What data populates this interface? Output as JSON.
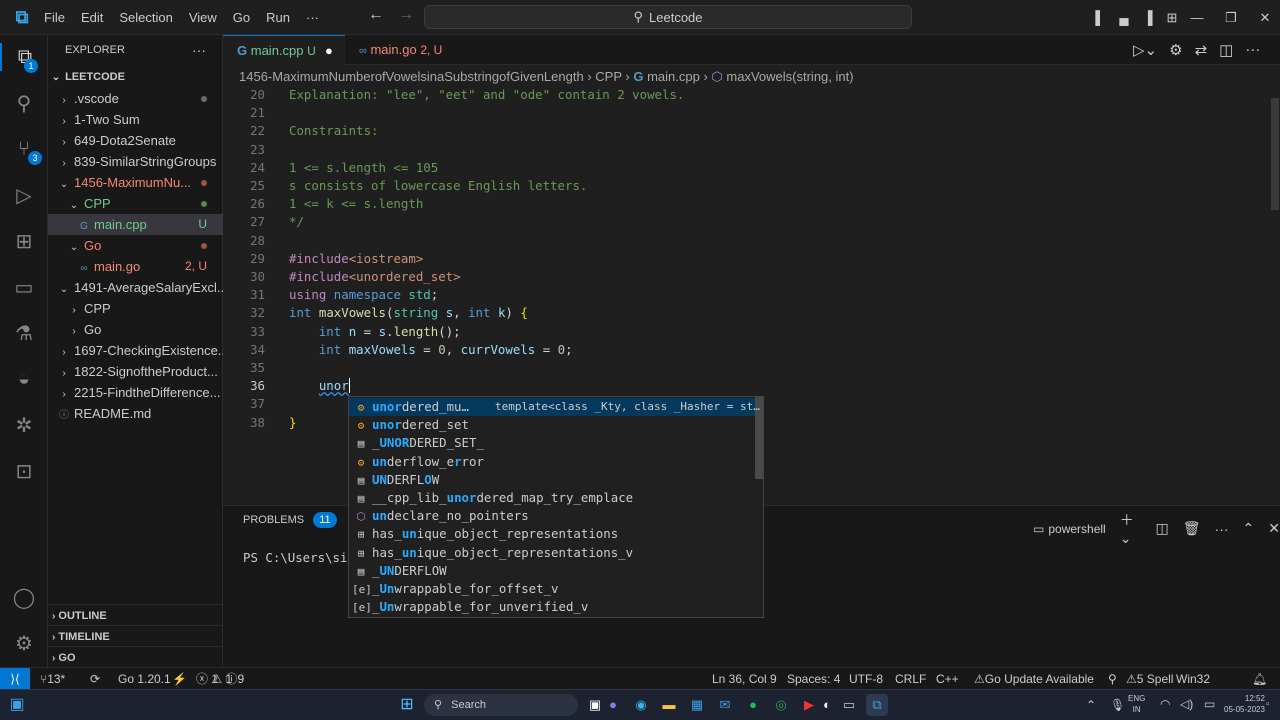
{
  "titlebar": {
    "menu": [
      "File",
      "Edit",
      "Selection",
      "View",
      "Go",
      "Run",
      "···"
    ],
    "command_center": "Leetcode"
  },
  "activity": {
    "explorer_badge": "1",
    "scm_badge": "3"
  },
  "sidebar": {
    "title": "EXPLORER",
    "root": "LEETCODE",
    "items": [
      {
        "label": ".vscode",
        "depth": 1,
        "chev": "›",
        "color": "#cccccc",
        "deco": "dot-gray"
      },
      {
        "label": "1-Two Sum",
        "depth": 1,
        "chev": "›",
        "color": "#cccccc"
      },
      {
        "label": "649-Dota2Senate",
        "depth": 1,
        "chev": "›",
        "color": "#cccccc"
      },
      {
        "label": "839-SimilarStringGroups",
        "depth": 1,
        "chev": "›",
        "color": "#cccccc"
      },
      {
        "label": "1456-MaximumNu...",
        "depth": 1,
        "chev": "⌄",
        "color": "#f48771",
        "deco": "dot-red"
      },
      {
        "label": "CPP",
        "depth": 2,
        "chev": "⌄",
        "color": "#73c991",
        "deco": "dot-green"
      },
      {
        "label": "main.cpp",
        "depth": 3,
        "chev": "",
        "color": "#73c991",
        "deco_text": "U",
        "selected": true
      },
      {
        "label": "Go",
        "depth": 2,
        "chev": "⌄",
        "color": "#f48771",
        "deco": "dot-red"
      },
      {
        "label": "main.go",
        "depth": 3,
        "chev": "",
        "color": "#f48771",
        "deco_text": "2, U"
      },
      {
        "label": "1491-AverageSalaryExcl...",
        "depth": 1,
        "chev": "⌄",
        "color": "#cccccc"
      },
      {
        "label": "CPP",
        "depth": 2,
        "chev": "›",
        "color": "#cccccc"
      },
      {
        "label": "Go",
        "depth": 2,
        "chev": "›",
        "color": "#cccccc"
      },
      {
        "label": "1697-CheckingExistence...",
        "depth": 1,
        "chev": "›",
        "color": "#cccccc"
      },
      {
        "label": "1822-SignoftheProduct...",
        "depth": 1,
        "chev": "›",
        "color": "#cccccc"
      },
      {
        "label": "2215-FindtheDifference...",
        "depth": 1,
        "chev": "›",
        "color": "#cccccc"
      },
      {
        "label": "README.md",
        "depth": 1,
        "chev": "",
        "color": "#cccccc",
        "icon": "info-icon"
      }
    ],
    "sections": [
      "OUTLINE",
      "TIMELINE",
      "GO"
    ]
  },
  "tabs": [
    {
      "label": "main.cpp",
      "suffix": "U",
      "color": "#73c991",
      "active": true
    },
    {
      "label": "main.go",
      "suffix": "2, U",
      "color": "#f48771",
      "active": false
    }
  ],
  "breadcrumbs": [
    "1456-MaximumNumberofVowelsinaSubstringofGivenLength",
    "CPP",
    "main.cpp",
    "maxVowels(string, int)"
  ],
  "code_lines": [
    {
      "n": "20",
      "html": "<span class='cm'>Explanation: \"lee\", \"eet\" and \"ode\" contain 2 vowels.</span>"
    },
    {
      "n": "21",
      "html": ""
    },
    {
      "n": "22",
      "html": "<span class='cm'>Constraints:</span>"
    },
    {
      "n": "23",
      "html": ""
    },
    {
      "n": "24",
      "html": "<span class='cm'>1 &lt;= s.length &lt;= 105</span>"
    },
    {
      "n": "25",
      "html": "<span class='cm'>s consists of lowercase English letters.</span>"
    },
    {
      "n": "26",
      "html": "<span class='cm'>1 &lt;= k &lt;= s.length</span>"
    },
    {
      "n": "27",
      "html": "<span class='cm'>*/</span>"
    },
    {
      "n": "28",
      "html": ""
    },
    {
      "n": "29",
      "html": "<span class='pp'>#include</span><span class='cm' style='color:#ce9178'>&lt;iostream&gt;</span>"
    },
    {
      "n": "30",
      "html": "<span class='pp'>#include</span><span class='cm' style='color:#ce9178'>&lt;unordered_set&gt;</span>"
    },
    {
      "n": "31",
      "html": "<span class='pp'>using</span> <span class='kw'>namespace</span> <span class='ty'>std</span>;"
    },
    {
      "n": "32",
      "html": "<span class='kw'>int</span> <span class='fn'>maxVowels</span>(<span class='ty'>string</span> <span class='vr'>s</span>, <span class='kw'>int</span> <span class='vr'>k</span>) <span style='color:#ffd700'>{</span>"
    },
    {
      "n": "33",
      "html": "    <span class='kw'>int</span> <span class='vr'>n</span> = <span class='vr'>s</span>.<span class='fn'>length</span>();"
    },
    {
      "n": "34",
      "html": "    <span class='kw'>int</span> <span class='vr'>maxVowels</span> = <span class='nm'>0</span>, <span class='vr'>currVowels</span> = <span class='nm'>0</span>;"
    },
    {
      "n": "35",
      "html": ""
    },
    {
      "n": "36",
      "html": "    <span class='vr' style='text-decoration:underline wavy #3794ff'>unor</span><span style='border-left:1px solid #fff'></span>"
    },
    {
      "n": "37",
      "html": ""
    },
    {
      "n": "38",
      "html": "<span style='color:#ffd700'>}</span>"
    }
  ],
  "autocomplete": [
    {
      "icon": "⚙",
      "pre": "",
      "hl": "unor",
      "post": "dered_mu…",
      "detail": "template<class _Kty, class _Hasher = st…",
      "active": true,
      "icon_name": "class-icon"
    },
    {
      "icon": "⚙",
      "pre": "",
      "hl": "unor",
      "post": "dered_set",
      "icon_name": "class-icon"
    },
    {
      "icon": "▤",
      "pre": "_",
      "hl": "UNOR",
      "post": "DERED_SET_",
      "icon_name": "constant-icon"
    },
    {
      "icon": "⚙",
      "pre": "",
      "hl": "un",
      "post": "derflow_e",
      "hl2": "r",
      "post2": "ror",
      "icon_name": "class-icon"
    },
    {
      "icon": "▤",
      "pre": "",
      "hl": "UN",
      "post": "DERFL",
      "hl2": "O",
      "post2": "W",
      "icon_name": "constant-icon"
    },
    {
      "icon": "▤",
      "pre": "__cpp_lib_",
      "hl": "unor",
      "post": "dered_map_try_emplace",
      "icon_name": "constant-icon"
    },
    {
      "icon": "⬡",
      "pre": "",
      "hl": "un",
      "post": "declare_no_pointers",
      "icon_name": "module-icon"
    },
    {
      "icon": "⊞",
      "pre": "has_",
      "hl": "un",
      "post": "ique_object_representations",
      "icon_name": "struct-icon"
    },
    {
      "icon": "⊞",
      "pre": "has_",
      "hl": "un",
      "post": "ique_object_representations_v",
      "icon_name": "struct-icon"
    },
    {
      "icon": "▤",
      "pre": "_",
      "hl": "UN",
      "post": "DERFLOW",
      "icon_name": "constant-icon"
    },
    {
      "icon": "[e]",
      "pre": "_",
      "hl": "Un",
      "post": "wrappable_for_offset_v",
      "icon_name": "variable-icon"
    },
    {
      "icon": "[e]",
      "pre": "_",
      "hl": "Un",
      "post": "wrappable_for_unverified_v",
      "icon_name": "variable-icon"
    }
  ],
  "panel": {
    "problems_label": "PROBLEMS",
    "problems_count": "11",
    "shell": "powershell",
    "terminal_text": "PS C:\\Users\\si"
  },
  "status": {
    "branch": "13*",
    "go_version": "Go 1.20.1",
    "errors": "1",
    "warnings": "1",
    "infos": "9",
    "position": "Ln 36, Col 9",
    "spaces": "Spaces: 4",
    "encoding": "UTF-8",
    "eol": "CRLF",
    "language": "C++",
    "go_update": "Go Update Available",
    "spell": "5 Spell",
    "platform": "Win32"
  },
  "taskbar": {
    "search": "Search",
    "lang_top": "ENG",
    "lang_bottom": "IN",
    "time": "12:52",
    "date": "05-05-2023"
  }
}
